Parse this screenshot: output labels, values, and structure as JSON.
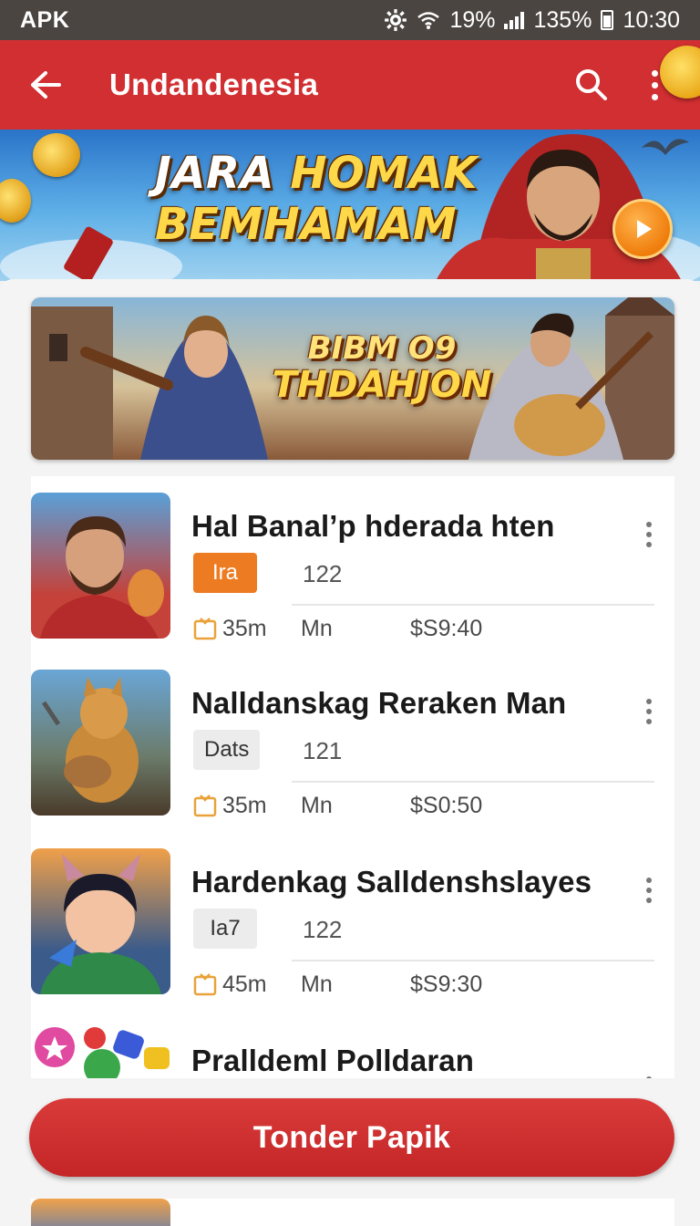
{
  "status_bar": {
    "left_label": "APK",
    "wifi_percent": "19%",
    "battery_percent": "135%",
    "time": "10:30"
  },
  "app_bar": {
    "title": "Undandenesia",
    "icons": [
      "back-arrow-icon",
      "search-icon",
      "more-vert-icon"
    ]
  },
  "hero": {
    "title_line1_a": "JARA",
    "title_line1_b": "HOMAK",
    "title_line2": "BEMHAMAM",
    "play_icon": "play-icon"
  },
  "promo": {
    "title_line1": "BIBM O9",
    "title_line2": "THDAHJON"
  },
  "list": {
    "items": [
      {
        "title": "Hal Banal’p hderada hten",
        "tag": "Ira",
        "tag_style": "orange",
        "count": "122",
        "duration": "35m",
        "label": "Mn",
        "price": "$S9:40"
      },
      {
        "title": "Nalldanskag Reraken Man",
        "tag": "Dats",
        "tag_style": "gray",
        "count": "121",
        "duration": "35m",
        "label": "Mn",
        "price": "$S0:50"
      },
      {
        "title": "Hardenkag Salldenshslayes",
        "tag": "Ia7",
        "tag_style": "gray",
        "count": "122",
        "duration": "45m",
        "label": "Mn",
        "price": "$S9:30"
      },
      {
        "title": "Pralldeml Polldaran"
      }
    ]
  },
  "cta": {
    "label": "Tonder Papik"
  },
  "colors": {
    "primary": "#d12f31",
    "accent": "#ed7b22",
    "status_bar": "#4a4541"
  }
}
